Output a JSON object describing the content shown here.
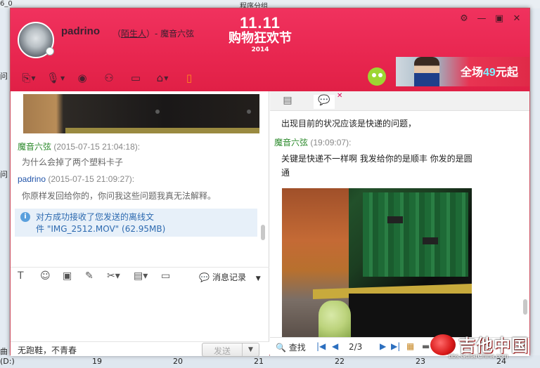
{
  "background": {
    "top_left_text": "6_0",
    "top_center_text": "程序分组",
    "left_texts": [
      "问",
      "问",
      "曲",
      "(D:)"
    ],
    "bottom_dates": [
      "19",
      "20",
      "21",
      "22",
      "23",
      "24"
    ]
  },
  "window": {
    "username": "padrino",
    "relation_open": "（",
    "relation_link": "陌生人",
    "relation_close": "）- 魔音六弦",
    "promo_line1": "11.11",
    "promo_line2": "购物狂欢节",
    "promo_year": "2014",
    "ad_prefix": "全场",
    "ad_number": "49",
    "ad_suffix": "元起"
  },
  "left_chat": {
    "messages": [
      {
        "sender": "魔音六弦",
        "time": "(2015-07-15 21:04:18):",
        "text": "为什么会掉了两个塑料卡子"
      },
      {
        "sender": "padrino",
        "time": "(2015-07-15 21:09:27):",
        "text": "你原样发回给你的，你问我这些问题我真无法解释。"
      }
    ],
    "notice_line1": "对方成功接收了您发送的离线文",
    "notice_line2": "件 \"IMG_2512.MOV\" (62.95MB)",
    "history_label": "消息记录",
    "signature": "无跑鞋，不青春",
    "send_label": "发送"
  },
  "right_chat": {
    "line_top": "出现目前的状况应该是快递的问题，",
    "sender": "魔音六弦",
    "time": "(19:09:07):",
    "body_line1": "关键是快递不一样啊     我发给你的是顺丰     你发的是圆",
    "body_line2": "通",
    "find_label": "查找",
    "page_indicator": "2/3"
  },
  "watermark": {
    "site_name": "吉他中国",
    "site_url": "bbs.GuitarChina.com"
  },
  "colors": {
    "header_red": "#e8264f",
    "sender_green": "#2c8a2c",
    "sender_blue": "#2255aa",
    "notice_bg": "#e7f0f9"
  },
  "icons": {
    "toolbar": [
      "file-transfer-icon",
      "voice-call-icon",
      "screen-share-icon",
      "add-contact-icon",
      "remote-assist-icon",
      "app-icon",
      "phone-transfer-icon"
    ],
    "edit": [
      "font-icon",
      "emoji-icon",
      "image-icon",
      "edit-icon",
      "scissors-icon",
      "table-icon",
      "screen-icon"
    ]
  }
}
